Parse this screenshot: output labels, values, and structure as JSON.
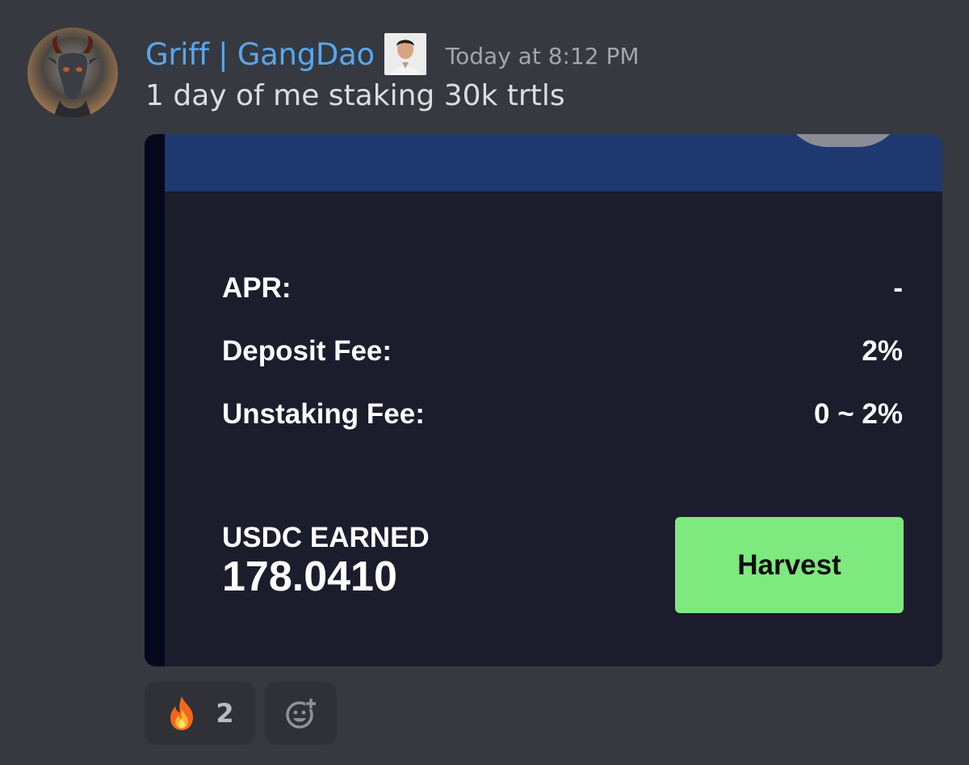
{
  "message": {
    "author": "Griff | GangDao",
    "timestamp": "Today at 8:12 PM",
    "text": "1 day of me staking 30k trtls"
  },
  "card": {
    "apr_label": "APR:",
    "apr_value": "-",
    "deposit_fee_label": "Deposit Fee:",
    "deposit_fee_value": "2%",
    "unstaking_fee_label": "Unstaking Fee:",
    "unstaking_fee_value": "0 ~ 2%",
    "earned_label": "USDC EARNED",
    "earned_value": "178.0410",
    "harvest_label": "Harvest"
  },
  "reactions": [
    {
      "emoji": "fire-icon",
      "count": "2"
    }
  ],
  "colors": {
    "username": "#58a6f0",
    "background": "#36393f",
    "card_background": "#1b1c2c",
    "card_header": "#1d3970",
    "harvest_button": "#7ee97f"
  }
}
